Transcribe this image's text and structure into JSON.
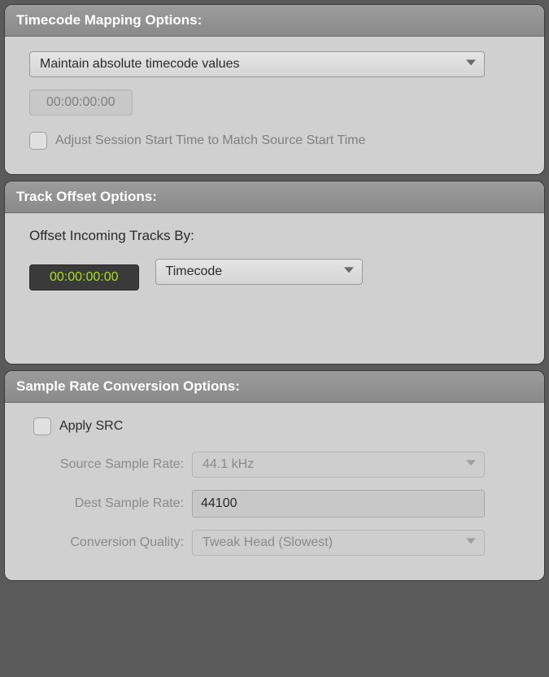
{
  "timecode_mapping": {
    "header": "Timecode Mapping Options:",
    "dropdown_value": "Maintain absolute timecode values",
    "timecode_value": "00:00:00:00",
    "adjust_checkbox_label": "Adjust Session Start Time to Match Source Start Time"
  },
  "track_offset": {
    "header": "Track Offset Options:",
    "field_label": "Offset Incoming Tracks By:",
    "timecode_value": "00:00:00:00",
    "unit_dropdown": "Timecode"
  },
  "sample_rate": {
    "header": "Sample Rate Conversion Options:",
    "apply_src_label": "Apply SRC",
    "source_label": "Source Sample Rate:",
    "source_value": "44.1 kHz",
    "dest_label": "Dest Sample Rate:",
    "dest_value": "44100",
    "quality_label": "Conversion Quality:",
    "quality_value": "Tweak Head (Slowest)"
  }
}
